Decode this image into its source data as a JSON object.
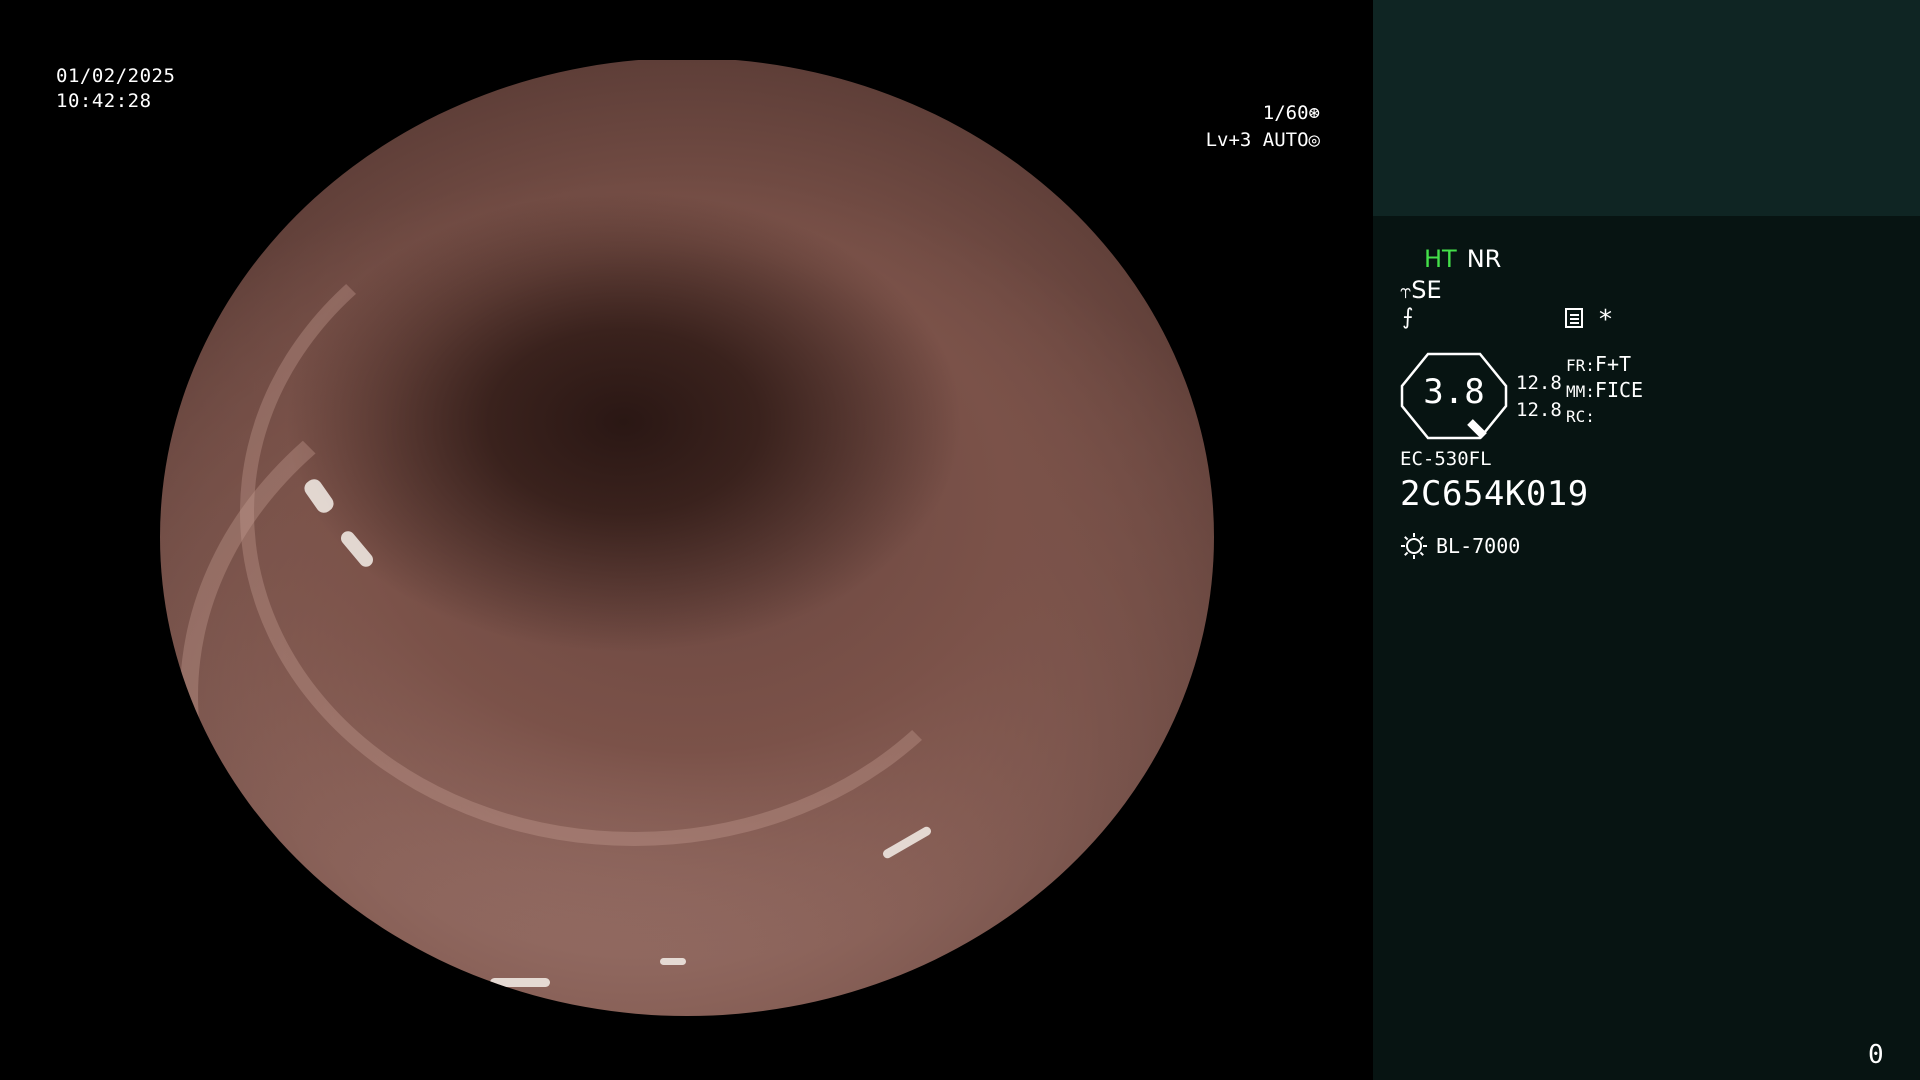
{
  "overlay": {
    "date": "01/02/2025",
    "time": "10:42:28",
    "shutter_speed": "1/60",
    "iris_mode": "Lv+3 AUTO"
  },
  "panel": {
    "ht_label": "HT",
    "nr_label": "NR",
    "se_label": "SE",
    "fx_symbol": "⨍",
    "star_symbol": "*",
    "zoom_value": "3.8",
    "value_1": "12.8",
    "value_2": "12.8",
    "fr_label": "FR:",
    "fr_value": "F+T",
    "mm_label": "MM:",
    "mm_value": "FICE",
    "rc_label": "RC:",
    "scope_model": "EC-530FL",
    "scope_serial": "2C654K019",
    "light_source": "BL-7000",
    "page_number": "0"
  },
  "colors": {
    "panel_background": "#071412",
    "panel_top_background": "#0f2523",
    "ht_active": "#44e04a"
  }
}
